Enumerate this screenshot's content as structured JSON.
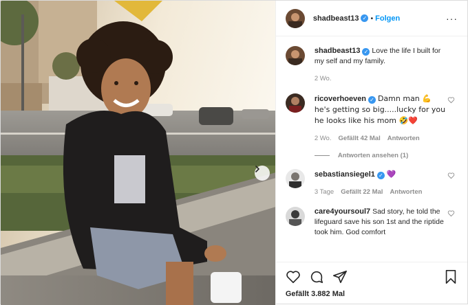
{
  "post": {
    "author": "shadbeast13",
    "follow_label": "Folgen",
    "separator": "•",
    "more_label": "···"
  },
  "caption": {
    "username": "shadbeast13",
    "text": "Love the life I built for my self and my family.",
    "time": "2 Wo."
  },
  "comments": [
    {
      "username": "ricoverhoeven",
      "text": "Damn man 💪 he's getting so big.....lucky for you he looks like his mom 🤣❤️",
      "time": "2 Wo.",
      "likes": "Gefällt 42 Mal",
      "reply": "Antworten",
      "verified": true
    },
    {
      "username": "sebastiansiegel1",
      "text": "💜",
      "time": "3 Tage",
      "likes": "Gefällt 22 Mal",
      "reply": "Antworten",
      "verified": true
    },
    {
      "username": "care4yoursoul7",
      "text": "Sad story, he told the lifeguard save his son 1st and the riptide took him. God comfort",
      "verified": false
    }
  ],
  "replies_toggle": "Antworten ansehen (1)",
  "footer": {
    "likes": "Gefällt 3.882 Mal"
  },
  "colors": {
    "accent": "#0095f6",
    "verified": "#3897f0",
    "muted": "#8e8e8e"
  },
  "icons": [
    "heart-icon",
    "comment-icon",
    "share-icon",
    "bookmark-icon",
    "chevron-right-icon",
    "verified-badge-icon"
  ]
}
